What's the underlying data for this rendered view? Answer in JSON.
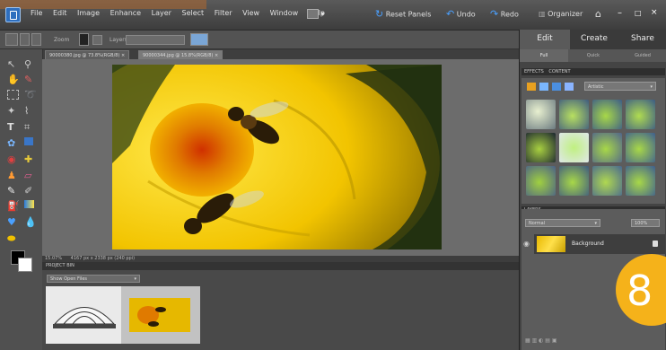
{
  "menubar": {
    "items": [
      "File",
      "Edit",
      "Image",
      "Enhance",
      "Layer",
      "Select",
      "Filter",
      "View",
      "Window",
      "Help"
    ],
    "reset_panels": "Reset Panels",
    "undo": "Undo",
    "redo": "Redo",
    "organizer": "Organizer"
  },
  "optionsbar": {
    "label_a": "Zoom",
    "label_b": "Layers"
  },
  "doc_tabs": [
    "90000380.jpg @ 73.8%(RGB/8)",
    "90000344.jpg @ 15.8%(RGB/8)"
  ],
  "status": {
    "zoom": "15.07%",
    "info": "4167 px x 2338 px (240 ppi)"
  },
  "project_bin": {
    "title": "PROJECT BIN",
    "select": "Show Open Files"
  },
  "right_panel": {
    "top_tabs": [
      "Edit",
      "Create",
      "Share"
    ],
    "sub_tabs": [
      "Full",
      "Quick",
      "Guided"
    ],
    "effects_header": "EFFECTS",
    "content_header": "CONTENT",
    "effects_filter": "Artistic",
    "layers_header": "LAYERS",
    "layers_mode": "Normal",
    "layers_opacity": "100%",
    "layer_name": "Background"
  },
  "badge": "8",
  "colors": {
    "accent_orange": "#f5b21a",
    "ui_dark": "#3a3a3a"
  }
}
